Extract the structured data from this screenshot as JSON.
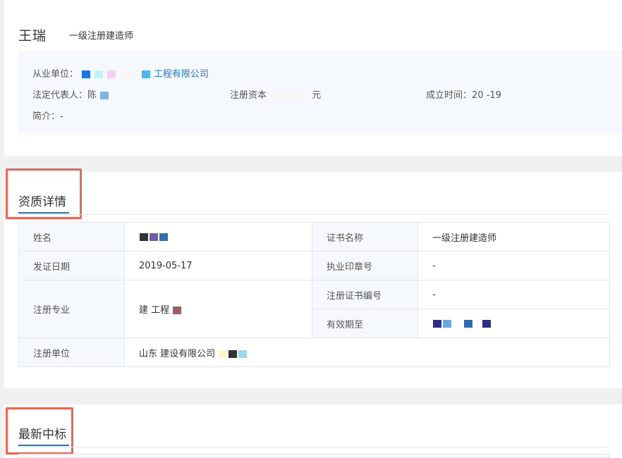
{
  "profile": {
    "name": "王瑞",
    "title": "一级注册建造师"
  },
  "company": {
    "employer_label": "从业单位：",
    "employer_value": "工程有限公司",
    "legal_rep_label": "法定代表人：",
    "legal_rep_value": "陈",
    "capital_label": "注册资本",
    "capital_value": "元",
    "founded_label": "成立时间：",
    "founded_value": "20  -19",
    "intro_label": "简介：",
    "intro_value": "-"
  },
  "qualification": {
    "section_title": "资质详情",
    "name_label": "姓名",
    "name_value": "",
    "cert_name_label": "证书名称",
    "cert_name_value": "一级注册建造师",
    "issue_date_label": "发证日期",
    "issue_date_value": "2019-05-17",
    "seal_no_label": "执业印章号",
    "seal_no_value": "-",
    "major_label": "注册专业",
    "major_value": "建  工程",
    "cert_no_label": "注册证书编号",
    "cert_no_value": "-",
    "valid_until_label": "有效期至",
    "valid_until_value": "",
    "reg_unit_label": "注册单位",
    "reg_unit_value": "山东  建设有限公司"
  },
  "bids": {
    "section_title": "最新中标"
  },
  "colors": {
    "accent": "#1f78d1",
    "highlight": "#f06451",
    "panel_bg": "#f5f9fd"
  }
}
